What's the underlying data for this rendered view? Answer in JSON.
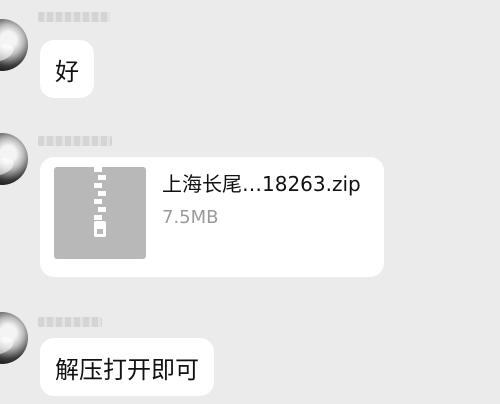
{
  "messages": [
    {
      "type": "text",
      "text": "好"
    },
    {
      "type": "file",
      "file_name": "上海长尾…18263.zip",
      "file_size": "7.5MB",
      "file_icon": "zip-archive-icon"
    },
    {
      "type": "text",
      "text": "解压打开即可"
    }
  ],
  "colors": {
    "background": "#ebebeb",
    "bubble": "#ffffff",
    "text": "#111111",
    "secondary_text": "#9a9a9a",
    "file_icon_bg": "#b8b8b8"
  }
}
